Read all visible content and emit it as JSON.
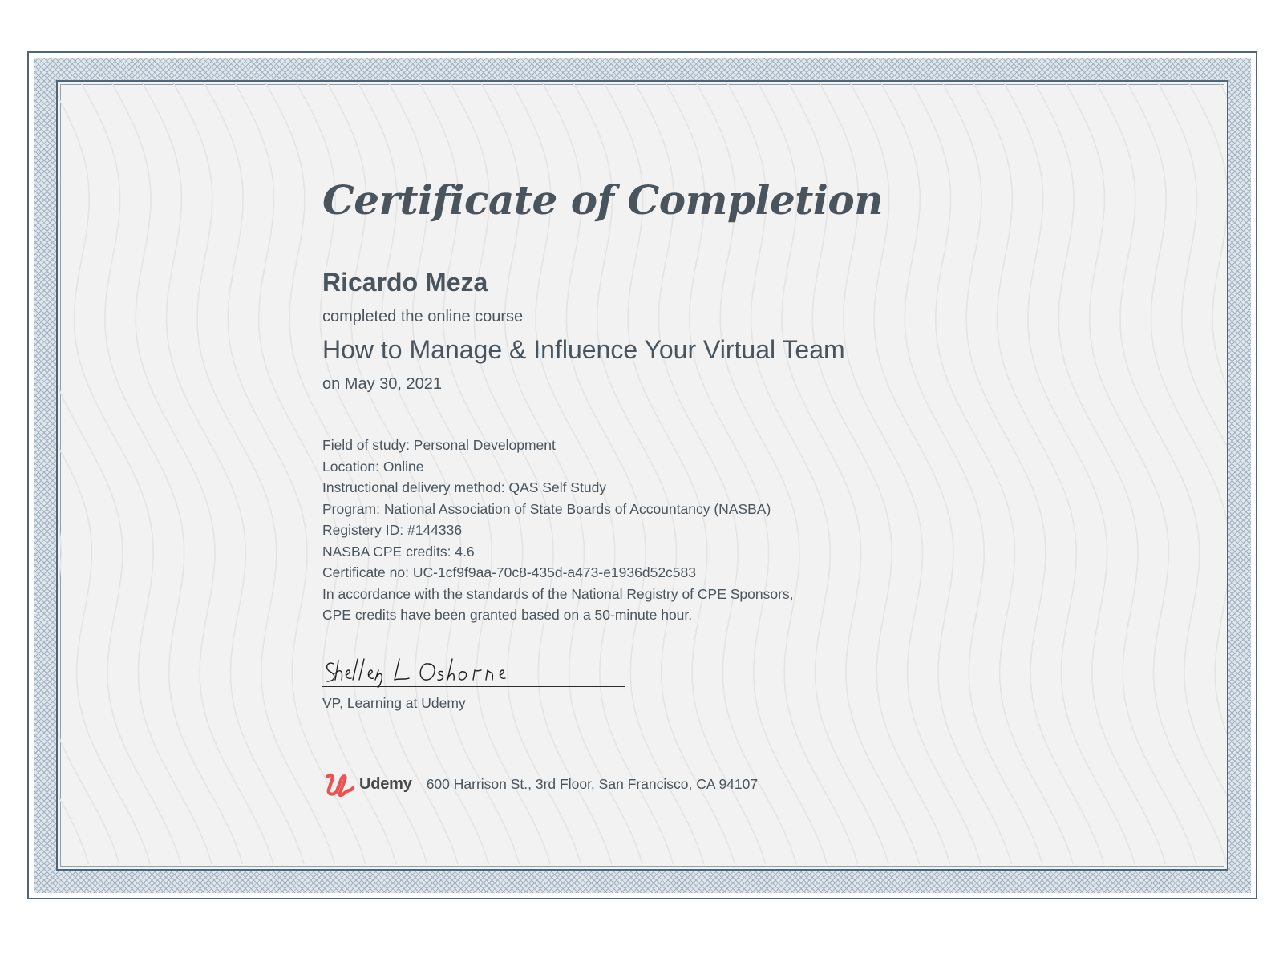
{
  "certificate": {
    "title": "Certificate of Completion",
    "recipient": "Ricardo Meza",
    "completed_text": "completed the online course",
    "course_title": "How to Manage & Influence Your Virtual Team",
    "completion_date": "on May 30, 2021"
  },
  "details": [
    "Field of study: Personal Development",
    "Location: Online",
    "Instructional delivery method: QAS Self Study",
    "Program: National Association of State Boards of Accountancy (NASBA)",
    "Registery ID: #144336",
    "NASBA CPE credits: 4.6",
    "Certificate no: UC-1cf9f9aa-70c8-435d-a473-e1936d52c583",
    "In accordance with the standards of the National Registry of CPE Sponsors,",
    "CPE credits have been granted based on a 50-minute hour."
  ],
  "signature": {
    "handwritten_name": "Shelley L Osborne",
    "signer_title": "VP, Learning at Udemy"
  },
  "footer": {
    "brand": "Udemy",
    "address": "600 Harrison St., 3rd Floor, San Francisco, CA 94107"
  },
  "colors": {
    "frame": "#4f6578",
    "text": "#4a545c",
    "udemy_red": "#ec5252",
    "background": "#f2f2f2"
  }
}
